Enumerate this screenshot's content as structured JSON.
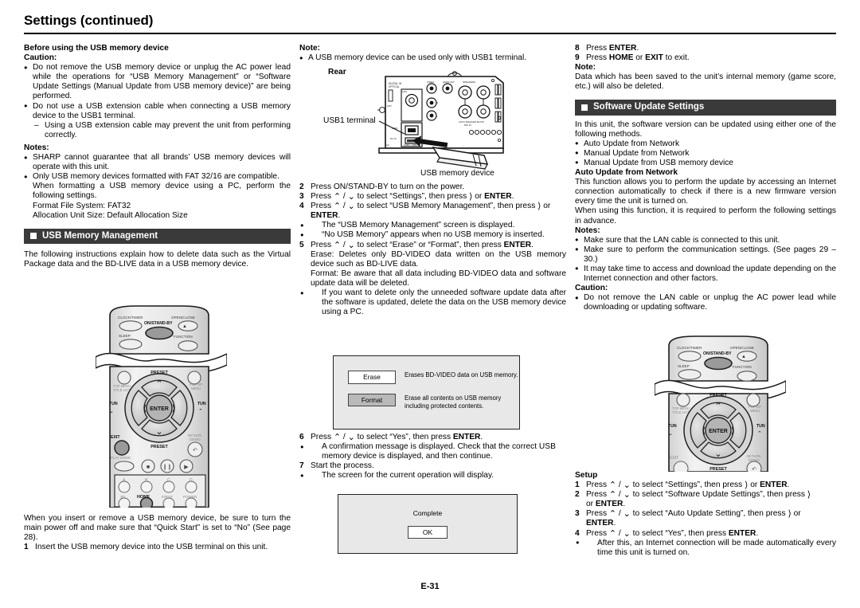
{
  "page": {
    "title": "Settings (continued)",
    "footer": "E-31"
  },
  "col1": {
    "heading_before_usb": "Before using the USB memory device",
    "caution_label": "Caution:",
    "caution_b1": "Do not remove the USB memory device or unplug the AC power lead while the operations for “USB Memory Management” or “Software Update Settings (Manual Update from USB memory device)” are being performed.",
    "caution_b2": "Do not use a USB extension cable when connecting a USB memory device to the USB1 terminal.",
    "caution_b2_dash": "Using a USB extension cable may prevent the unit from performing correctly.",
    "notes_label": "Notes:",
    "note_b1": "SHARP cannot guarantee that all brands’ USB memory devices will operate with this unit.",
    "note_b2": "Only USB memory devices formatted with FAT 32/16 are compatible.",
    "note_b2_l1": "When formatting a USB memory device using a PC, perform the following settings.",
    "note_b2_l2": "Format File System: FAT32",
    "note_b2_l3": "Allocation Unit Size: Default Allocation Size",
    "section_usb_mgmt": "USB Memory Management",
    "usb_mgmt_intro": "The following instructions explain how to delete data such as the Virtual Package data and the BD-LIVE data in a USB memory device.",
    "insert_note": "When you insert or remove a USB memory device, be sure to turn the main power off and make sure that “Quick Start” is set to “No” (See page 28).",
    "step1_num": "1",
    "step1_text": "Insert the USB memory device into the USB terminal on this unit."
  },
  "col2": {
    "note_label": "Note:",
    "note_b1": "A USB memory device can be used only with USB1 terminal.",
    "rear_label": "Rear",
    "usb1_terminal_label": "USB1 terminal",
    "usb_memory_device_label": "USB memory device",
    "step2_num": "2",
    "step2_text": "Press ON/STAND-BY to turn on the power.",
    "step3_num": "3",
    "step3_pre": "Press ",
    "step3_mid": " to select “Settings”, then press ",
    "step3_post": " or ",
    "step3_enter": "ENTER",
    "step3_end": ".",
    "step4_num": "4",
    "step4_pre": "Press ",
    "step4_mid": " to select “USB Memory Management”, then press ",
    "step4_post": " or ",
    "step4_enter": "ENTER",
    "step4_end": ".",
    "step4_b1": "The “USB Memory Management” screen is displayed.",
    "step4_b2": "“No USB Memory” appears when no USB memory is inserted.",
    "step5_num": "5",
    "step5_pre": "Press ",
    "step5_mid": " to select “Erase” or “Format”, then press ",
    "step5_enter": "ENTER",
    "step5_end": ".",
    "step5_erase": "Erase: Deletes only BD-VIDEO data written on the USB memory device such as BD-LIVE data.",
    "step5_format": "Format: Be aware that all data including BD-VIDEO data and software update data will be deleted.",
    "step5_b1": "If you want to delete only the unneeded software update data after the software is updated, delete the data on the USB memory device using a PC.",
    "osd_erase_btn": "Erase",
    "osd_erase_desc": "Erases BD-VIDEO data on USB memory.",
    "osd_format_btn": "Format",
    "osd_format_desc_l1": "Erase all contents on USB memory",
    "osd_format_desc_l2": "including protected contents.",
    "step6_num": "6",
    "step6_pre": "Press ",
    "step6_mid": " to select “Yes”, then press ",
    "step6_enter": "ENTER",
    "step6_end": ".",
    "step6_b1": "A confirmation message is displayed. Check that the correct USB memory device is displayed, and then continue.",
    "step7_num": "7",
    "step7_text": "Start the process.",
    "step7_b1": "The screen for the current operation will display.",
    "osd_complete_msg": "Complete",
    "osd_complete_ok": "OK"
  },
  "col3": {
    "step8_num": "8",
    "step8_pre": "Press ",
    "step8_enter": "ENTER",
    "step8_end": ".",
    "step9_num": "9",
    "step9_pre": "Press ",
    "step9_home": "HOME",
    "step9_or": " or ",
    "step9_exit": "EXIT",
    "step9_end": " to exit.",
    "note_label": "Note:",
    "note_text": "Data which has been saved to the unit’s internal memory (game score, etc.) will also be deleted.",
    "section_software_update": "Software Update Settings",
    "su_intro": "In this unit, the software version can be updated using either one of the following methods.",
    "su_m1": "Auto Update from Network",
    "su_m2": "Manual Update from Network",
    "su_m3": "Manual Update from USB memory device",
    "auto_update_heading": "Auto Update from Network",
    "auto_update_p1": "This function allows you to perform the update by accessing an Internet connection automatically to check if there is a new firmware version every time the unit is turned on.",
    "auto_update_p2": "When using this function, it is required to perform the following settings in advance.",
    "notes_label": "Notes:",
    "note_b1": "Make sure that the LAN cable is connected to this unit.",
    "note_b2": "Make sure to perform the communication settings. (See pages 29 –30.)",
    "note_b3": "It may take time to access and download the update depending on the Internet connection and other factors.",
    "caution_label": "Caution:",
    "caution_b1": "Do not remove the LAN cable or unplug the AC power lead while downloading or updating software.",
    "setup_heading": "Setup",
    "setup1_num": "1",
    "setup1_pre": "Press ",
    "setup1_mid": " to select “Settings”, then press ",
    "setup1_post": " or ",
    "setup1_enter": "ENTER",
    "setup1_end": ".",
    "setup2_num": "2",
    "setup2_pre": "Press ",
    "setup2_mid": " to select “Software Update Settings”, then press ",
    "setup2_post2": "or ",
    "setup2_enter": "ENTER",
    "setup2_end": ".",
    "setup3_num": "3",
    "setup3_pre": "Press ",
    "setup3_mid": " to select “Auto Update Setting”, then press ",
    "setup3_post": " or",
    "setup3_enter": "ENTER",
    "setup3_end": ".",
    "setup4_num": "4",
    "setup4_pre": "Press ",
    "setup4_mid": " to select “Yes”, then press ",
    "setup4_enter": "ENTER",
    "setup4_end": ".",
    "setup4_b1": "After this, an Internet connection will be made automatically every time this unit is turned on."
  },
  "remote": {
    "clock_timer": "CLOCK/TIMER",
    "open_close": "OPEN/CLOSE",
    "on_standby": "ON/STAND-BY",
    "sleep": "SLEEP",
    "function": "FUNCTION",
    "preset_up": "PRESET",
    "preset_down": "PRESET",
    "top_menu": "TOP MENU",
    "title_list": "TITLE LIST",
    "popup_menu": "POP-UP",
    "popup_menu2": "MENU",
    "tun_down": "TUN",
    "tun_up": "TUN",
    "enter": "ENTER",
    "exit": "EXIT",
    "return_demo": "RETURN",
    "return_demo2": "/DEMO",
    "play_mode": "PLAY MODE",
    "btn_a": "A",
    "btn_b": "B",
    "btn_c": "C",
    "btn_d": "D",
    "three_d": "3D",
    "home": "HOME",
    "input": "INPUT",
    "power": "POWER"
  },
  "colors": {
    "section_bar": "#3a3a3a",
    "osd_bg": "#e8e8e8",
    "highlight_button": "#b9b9b9"
  }
}
